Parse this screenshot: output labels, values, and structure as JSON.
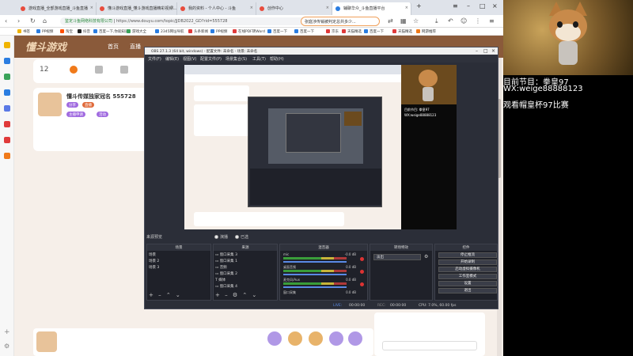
{
  "browser": {
    "tabs": [
      {
        "label": "游戏直播_全部游戏直播_斗鱼直播"
      },
      {
        "label": "懂斗游戏直播_懂斗游戏直播精彩视频..."
      },
      {
        "label": "我的资料 - 个人中心 - 斗鱼"
      },
      {
        "label": "创作中心"
      },
      {
        "label": "辅聊华众_斗鱼直播平台"
      }
    ],
    "new_tab": "+",
    "url_site": "鉴定斗鱼网络科技有限公司",
    "url_path": "https://www.douyu.com/topic/JJDB2022_GD?rid=555728",
    "search_text": "张庭涉传销被判定总共多少...",
    "bookmarks": [
      {
        "label": "书签",
        "color": "#f0b400"
      },
      {
        "label": "PP视频",
        "color": "#2a7de1"
      },
      {
        "label": "淘宝",
        "color": "#ff5000"
      },
      {
        "label": "抖音",
        "color": "#222222"
      },
      {
        "label": "百度一下,你就知道",
        "color": "#2a7de1"
      },
      {
        "label": "游戏大全",
        "color": "#3aa35a"
      },
      {
        "label": "2345网址导航",
        "color": "#2a7de1"
      },
      {
        "label": "头条新闻",
        "color": "#e03a3a"
      },
      {
        "label": "PP视频",
        "color": "#2a7de1"
      },
      {
        "label": "在线PDF转Word",
        "color": "#e03a3a"
      },
      {
        "label": "百度一下",
        "color": "#2a7de1"
      },
      {
        "label": "百度一下",
        "color": "#2a7de1"
      },
      {
        "label": "京东",
        "color": "#e03a3a"
      },
      {
        "label": "天猫精选",
        "color": "#e03a3a"
      },
      {
        "label": "百度一下",
        "color": "#2a7de1"
      },
      {
        "label": "天猫精选",
        "color": "#e03a3a"
      },
      {
        "label": "网游推荐",
        "color": "#f07a1a"
      }
    ]
  },
  "page": {
    "logo": "懂斗游戏",
    "nav": [
      "首页",
      "直播"
    ],
    "follow_count": "12",
    "room_title": "懂斗传媒独家冠名 555728",
    "badges": [
      "分享",
      "直播",
      "主播申请",
      "活动"
    ]
  },
  "obs": {
    "title": "OBS 27.1.3 (64 bit, windows) - 配置文件: 未命名 - 场景: 未命名",
    "menu": [
      "文件(F)",
      "编辑(E)",
      "视图(V)",
      "配置文件(P)",
      "场景集合(S)",
      "工具(T)",
      "帮助(H)"
    ],
    "mode_labels": [
      "来源预览",
      "演播",
      "已选"
    ],
    "docks": {
      "scenes": {
        "title": "场景",
        "items": [
          "场景",
          "场景 2",
          "场景 3"
        ]
      },
      "sources": {
        "title": "来源",
        "items": [
          "窗口采集 3",
          "窗口采集 1",
          "音频",
          "窗口采集 2",
          "媒体",
          "窗口采集 4"
        ]
      },
      "mixer": {
        "title": "混音器",
        "tracks": [
          {
            "label": "mic",
            "db": "-0.0 dB"
          },
          {
            "label": "桌面音频",
            "db": "0.0 dB"
          },
          {
            "label": "麦克风/Aux",
            "db": "0.0 dB"
          },
          {
            "label": "窗口采集",
            "db": "0.0 dB"
          }
        ]
      },
      "transitions": {
        "title": "转场特效",
        "value": "淡出"
      },
      "controls": {
        "title": "控件",
        "buttons": [
          "停止推流",
          "开始录制",
          "启动虚拟摄像机",
          "工作室模式",
          "设置",
          "退出"
        ]
      }
    },
    "status": {
      "live_label": "LIVE:",
      "live_time": "00:00:00",
      "rec_label": "REC:",
      "rec_time": "00:00:00",
      "cpu": "CPU: 7.0%, 60.00 fps"
    },
    "preview": {
      "nested_text": [
        "目前节目: 拳皇97",
        "WX:weige88888123"
      ]
    }
  },
  "stream_overlay": {
    "line1": "目前节目：拳皇97",
    "line2": "WX:weige88888123",
    "line3": "观看帽皇杯97比赛"
  },
  "colors": {
    "obs_bg": "#2b2e38",
    "page_bg": "#f6efe9",
    "accent": "#8a5a3a"
  }
}
